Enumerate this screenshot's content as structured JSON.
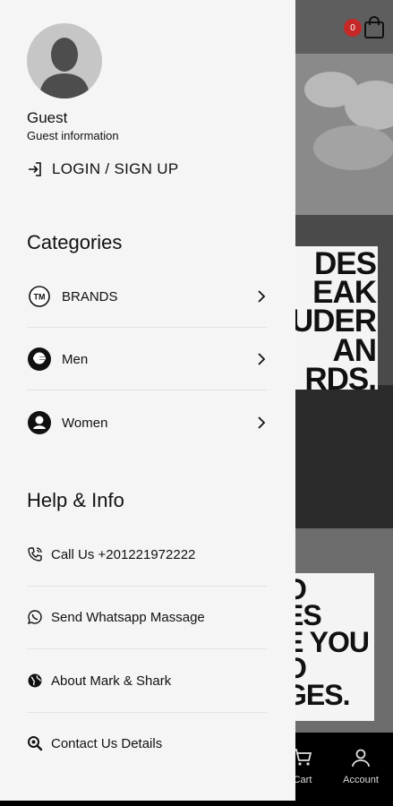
{
  "header": {
    "cart_count": "0"
  },
  "user": {
    "name": "Guest",
    "subtitle": "Guest information",
    "login_label": "LOGIN / SIGN UP"
  },
  "categories": {
    "title": "Categories",
    "items": [
      {
        "label": "BRANDS",
        "icon": "trademark-icon"
      },
      {
        "label": "Men",
        "icon": "men-icon"
      },
      {
        "label": "Women",
        "icon": "women-icon"
      }
    ]
  },
  "help": {
    "title": "Help & Info",
    "items": [
      {
        "label": "Call Us +201221972222",
        "icon": "phone-icon"
      },
      {
        "label": "Send Whatsapp Massage",
        "icon": "whatsapp-icon"
      },
      {
        "label": "About Mark & Shark",
        "icon": "globe-icon"
      },
      {
        "label": "Contact Us Details",
        "icon": "search-details-icon"
      }
    ]
  },
  "background": {
    "poster1_lines": [
      "DES",
      "EAK",
      "UDER",
      "AN",
      "RDS."
    ],
    "poster2_lines": [
      "O",
      "ES",
      "E YOU",
      "O",
      "GES."
    ]
  },
  "bottom_nav": {
    "cart_label": "Cart",
    "account_label": "Account"
  },
  "colors": {
    "drawer_bg": "#f5f5f5",
    "badge": "#c62828",
    "text": "#111111"
  }
}
